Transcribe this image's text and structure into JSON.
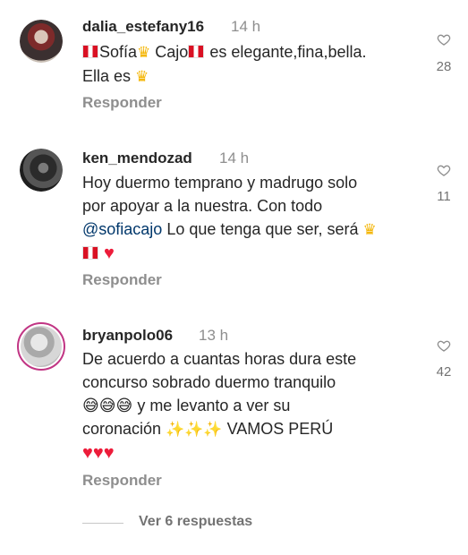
{
  "comments": [
    {
      "username": "dalia_estefany16",
      "time": "14 h",
      "text_line1_parts": [
        "Sofía",
        "Cajo",
        "es elegante,fina,bella."
      ],
      "text_line2": "Ella es",
      "reply_label": "Responder",
      "likes": "28"
    },
    {
      "username": "ken_mendozad",
      "time": "14 h",
      "line1": "Hoy duermo temprano y madrugo solo",
      "line2": "por apoyar a la nuestra. Con todo",
      "mention": "@sofiacajo",
      "line3_rest": "Lo que tenga que ser, será",
      "reply_label": "Responder",
      "likes": "11"
    },
    {
      "username": "bryanpolo06",
      "time": "13 h",
      "line1": "De acuerdo a cuantas horas dura este",
      "line2": "concurso sobrado duermo tranquilo",
      "line3": "y me levanto a ver su",
      "line4_a": "coronación",
      "line4_b": "VAMOS PERÚ",
      "reply_label": "Responder",
      "likes": "42"
    }
  ],
  "view_replies": "Ver 6 respuestas",
  "icons": [
    "heart-outline-icon",
    "heart-emoji-icon",
    "crown-emoji-icon",
    "peru-flag-emoji-icon",
    "sweat-smile-emoji-icon",
    "sparkles-emoji-icon"
  ],
  "colors": {
    "accent_ring": "#c13584",
    "mention": "#00376b",
    "muted": "#8e8e8e"
  }
}
